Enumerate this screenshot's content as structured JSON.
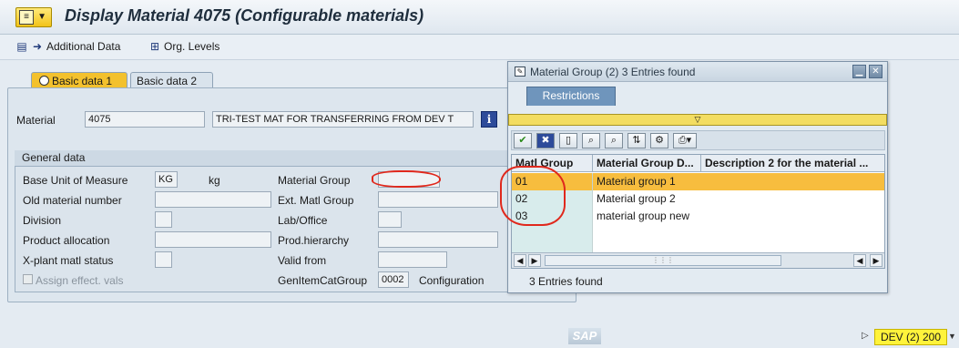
{
  "header": {
    "title": "Display Material 4075 (Configurable materials)"
  },
  "toolbar": {
    "items": [
      {
        "label": "Additional Data",
        "icon": "arrow-right-icon"
      },
      {
        "label": "Org. Levels",
        "icon": "org-tree-icon"
      }
    ]
  },
  "tabs": [
    {
      "label": "Basic data 1",
      "active": true
    },
    {
      "label": "Basic data 2",
      "active": false
    }
  ],
  "material": {
    "label": "Material",
    "number": "4075",
    "description": "TRI-TEST MAT FOR TRANSFERRING FROM DEV T"
  },
  "general": {
    "title": "General data",
    "base_uom_label": "Base Unit of Measure",
    "base_uom_value": "KG",
    "base_uom_text": "kg",
    "old_matnr_label": "Old material number",
    "division_label": "Division",
    "product_alloc_label": "Product allocation",
    "xplant_label": "X-plant matl status",
    "assign_label": "Assign effect. vals",
    "matl_group_label": "Material Group",
    "ext_matl_group_label": "Ext. Matl Group",
    "lab_office_label": "Lab/Office",
    "prod_hierarchy_label": "Prod.hierarchy",
    "valid_from_label": "Valid from",
    "gen_item_cat_label": "GenItemCatGroup",
    "gen_item_cat_value": "0002",
    "gen_item_cat_text": "Configuration"
  },
  "popup": {
    "title": "Material Group (2)    3 Entries found",
    "restrictions_tab": "Restrictions",
    "columns": [
      "Matl Group",
      "Material Group D...",
      "Description 2 for the material ..."
    ],
    "rows": [
      {
        "key": "01",
        "text": "Material group 1",
        "selected": true
      },
      {
        "key": "02",
        "text": "Material group 2",
        "selected": false
      },
      {
        "key": "03",
        "text": "material group new",
        "selected": false
      }
    ],
    "status": "3 Entries found"
  },
  "system": {
    "logo": "SAP",
    "session": "DEV (2) 200"
  }
}
